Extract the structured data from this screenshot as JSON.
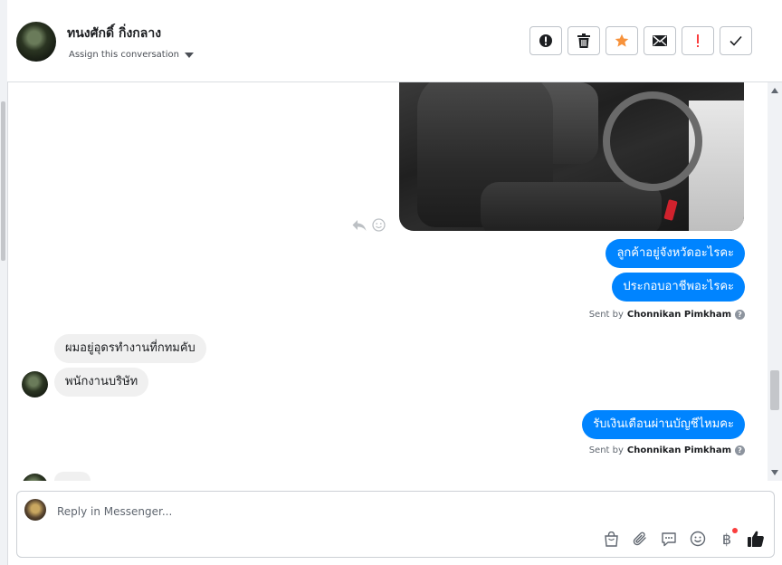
{
  "header": {
    "contact_name": "ทนงศักดิ์ กิ่งกลาง",
    "assign_label": "Assign this conversation"
  },
  "actions": [
    {
      "icon": "alert-circle-icon",
      "color": "#1c1e21"
    },
    {
      "icon": "trash-icon",
      "color": "#1c1e21"
    },
    {
      "icon": "star-icon",
      "color": "#f7923b"
    },
    {
      "icon": "envelope-icon",
      "color": "#1c1e21"
    },
    {
      "icon": "exclamation-icon",
      "color": "#fa3e3e"
    },
    {
      "icon": "check-icon",
      "color": "#1c1e21"
    }
  ],
  "messages": {
    "out1": "ลูกค้าอยู่จังหวัดอะไรคะ",
    "out2": "ประกอบอาชีพอะไรคะ",
    "sent_by_1_prefix": "Sent by",
    "sent_by_1_name": "Chonnikan Pimkham",
    "in1": "ผมอยู่อุดรทำงานที่กทมคับ",
    "in2": "พนักงานบริษัท",
    "out3": "รับเงินเดือนผ่านบัญชีไหมคะ",
    "sent_by_2_prefix": "Sent by",
    "sent_by_2_name": "Chonnikan Pimkham"
  },
  "composer": {
    "placeholder": "Reply in Messenger...",
    "tools": [
      "shopping-bag-icon",
      "paperclip-icon",
      "saved-reply-icon",
      "emoji-icon",
      "baht-icon",
      "thumbs-up-icon"
    ]
  },
  "colors": {
    "accent": "#0084ff",
    "incoming_bubble": "#f0f0f0",
    "notification_dot": "#fa3e3e"
  }
}
